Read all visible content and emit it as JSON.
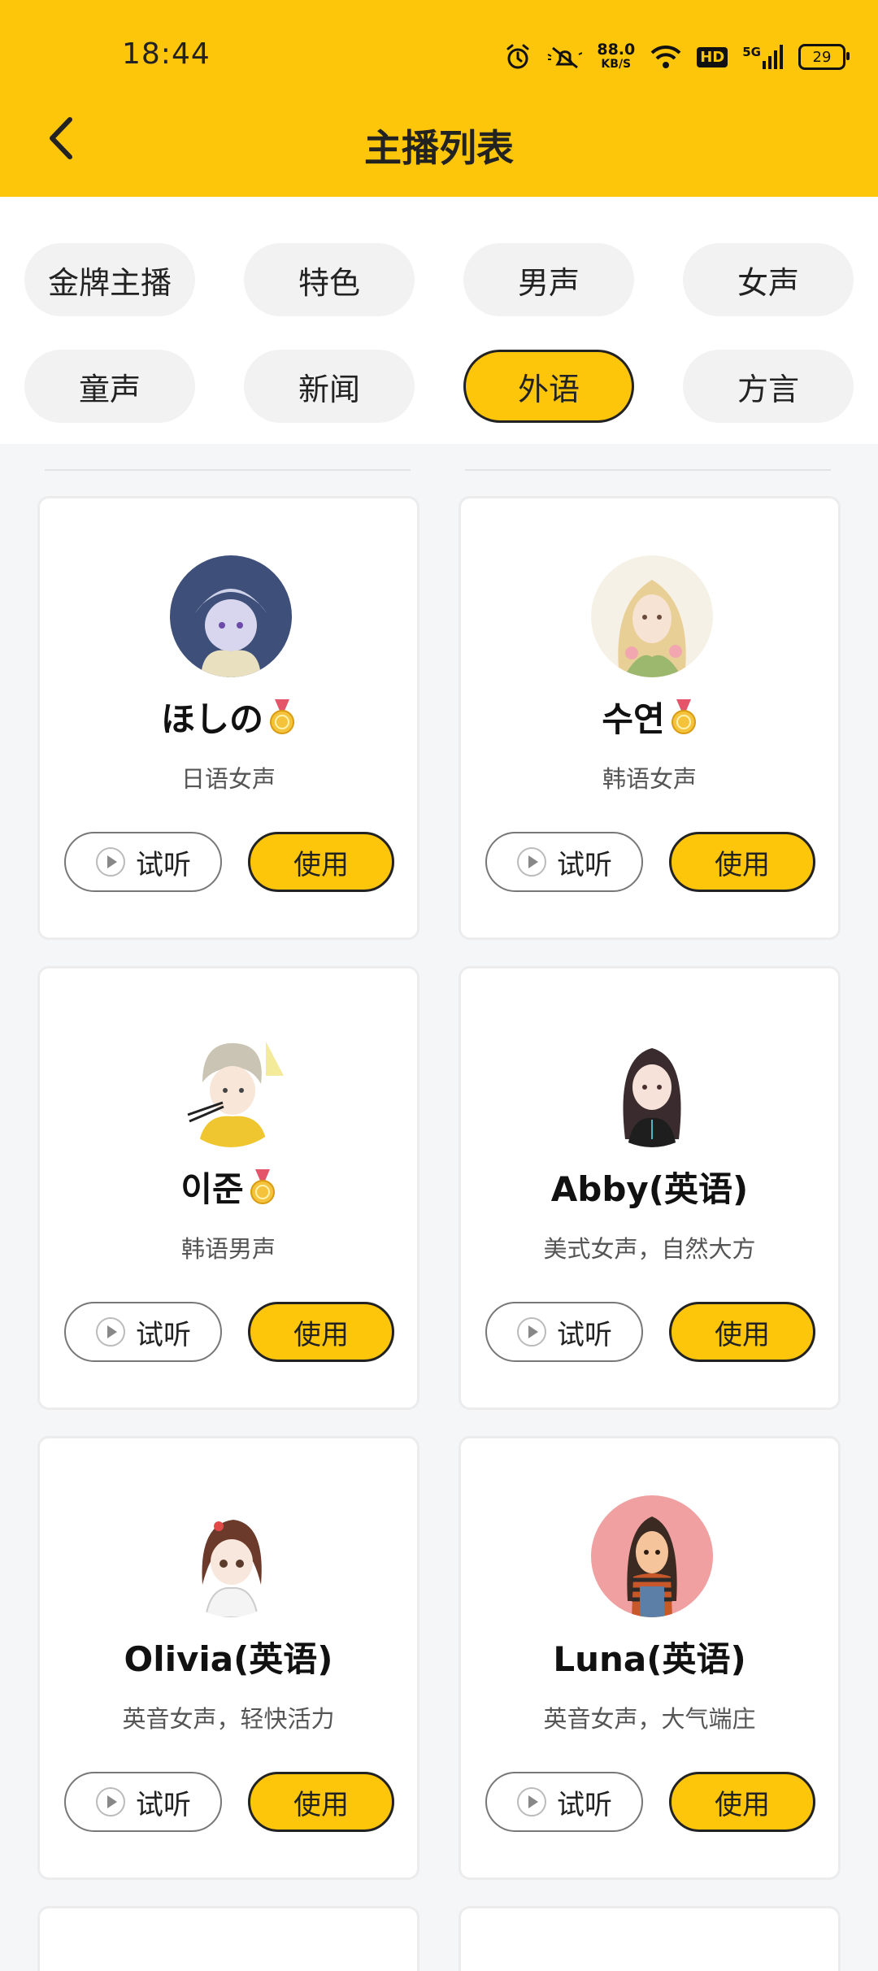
{
  "status_bar": {
    "time": "18:44",
    "speed_value": "88.0",
    "speed_unit": "KB/S",
    "hd": "HD",
    "network": "5G",
    "battery": "29"
  },
  "header": {
    "title": "主播列表",
    "back_icon": "chevron-left-icon"
  },
  "categories": [
    {
      "label": "金牌主播",
      "active": false
    },
    {
      "label": "特色",
      "active": false
    },
    {
      "label": "男声",
      "active": false
    },
    {
      "label": "女声",
      "active": false
    },
    {
      "label": "童声",
      "active": false
    },
    {
      "label": "新闻",
      "active": false
    },
    {
      "label": "外语",
      "active": true
    },
    {
      "label": "方言",
      "active": false
    }
  ],
  "cards": [
    {
      "name": "ほしの",
      "medal": true,
      "desc": "日语女声",
      "listen": "试听",
      "use": "使用"
    },
    {
      "name": "수연",
      "medal": true,
      "desc": "韩语女声",
      "listen": "试听",
      "use": "使用"
    },
    {
      "name": "이준",
      "medal": true,
      "desc": "韩语男声",
      "listen": "试听",
      "use": "使用"
    },
    {
      "name": "Abby(英语)",
      "medal": false,
      "desc": "美式女声，自然大方",
      "listen": "试听",
      "use": "使用"
    },
    {
      "name": "Olivia(英语)",
      "medal": false,
      "desc": "英音女声，轻快活力",
      "listen": "试听",
      "use": "使用"
    },
    {
      "name": "Luna(英语)",
      "medal": false,
      "desc": "英音女声，大气端庄",
      "listen": "试听",
      "use": "使用"
    }
  ],
  "colors": {
    "accent": "#fdc60a",
    "background": "#f5f6f8",
    "chip": "#f2f2f2"
  }
}
